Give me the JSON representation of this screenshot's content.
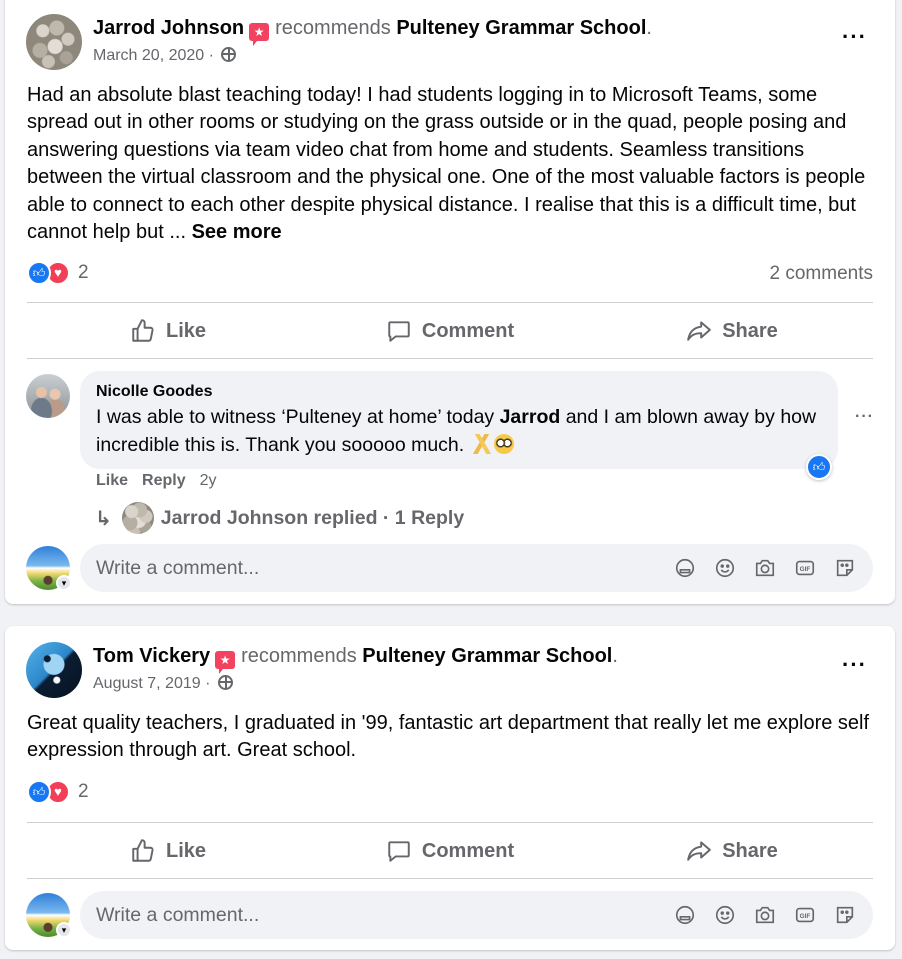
{
  "posts": [
    {
      "author": "Jarrod Johnson",
      "verb": "recommends",
      "page": "Pulteney Grammar School",
      "period": ".",
      "date": "March 20, 2020 ·",
      "text": "Had an absolute blast teaching today! I had students logging in to Microsoft Teams, some spread out in other rooms or studying on the grass outside or in the quad, people posing and answering questions via team video chat from home and students. Seamless transitions between the virtual classroom and the physical one. One of the most valuable factors is people able to connect to each other despite physical distance. I realise that this is a difficult time, but cannot help but ... ",
      "see_more": "See more",
      "reaction_count": "2",
      "comment_count": "2 comments",
      "actions": {
        "like": "Like",
        "comment": "Comment",
        "share": "Share"
      },
      "comment": {
        "author": "Nicolle Goodes",
        "text_before": "I was able to witness ‘Pulteney at home’ today ",
        "mention": "Jarrod",
        "text_after": " and I am blown away by how incredible this is. Thank you sooooo much. ",
        "like": "Like",
        "reply": "Reply",
        "age": "2y",
        "replies": "Jarrod Johnson replied · 1 Reply"
      },
      "write_placeholder": "Write a comment..."
    },
    {
      "author": "Tom Vickery",
      "verb": "recommends",
      "page": "Pulteney Grammar School",
      "period": ".",
      "date": "August 7, 2019 ·",
      "text": "Great quality teachers, I graduated in '99, fantastic art department that really let me explore self expression through art.  Great school.",
      "reaction_count": "2",
      "actions": {
        "like": "Like",
        "comment": "Comment",
        "share": "Share"
      },
      "write_placeholder": "Write a comment..."
    }
  ],
  "colors": {
    "like_blue": "#1877f2",
    "love_red": "#f33e58",
    "recommend_red": "#f3425f",
    "secondary_text": "#65676b",
    "bubble_bg": "#f0f2f5"
  },
  "icons": [
    "recommend-icon",
    "globe-icon",
    "more-icon",
    "like-icon",
    "comment-icon",
    "share-icon",
    "reply-arrow-icon",
    "sticker-icon",
    "emoji-icon",
    "camera-icon",
    "gif-icon",
    "smiley-sticker-icon"
  ]
}
